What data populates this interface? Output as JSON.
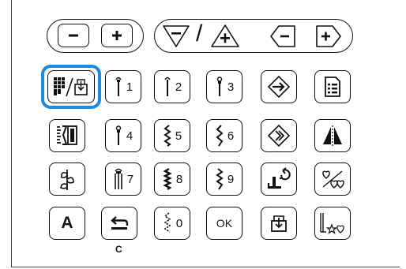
{
  "top_bar": {
    "width_minus": {
      "icon": "minus-icon"
    },
    "width_plus": {
      "icon": "plus-icon"
    },
    "length_minus": {
      "icon": "triangle-minus-icon"
    },
    "separator": "/",
    "length_plus": {
      "icon": "triangle-plus-icon"
    },
    "left_adjust": {
      "icon": "left-arrow-minus-icon"
    },
    "right_adjust": {
      "icon": "right-arrow-plus-icon"
    }
  },
  "keypad": {
    "rows": [
      [
        {
          "name": "stitch-pattern-select-button",
          "icon": "stitch-grid-icon",
          "selected": true,
          "accent": "#1f8be0"
        },
        {
          "name": "stitch-1-button",
          "number": "1",
          "icon": "straight-stitch-icon"
        },
        {
          "name": "stitch-2-button",
          "number": "2",
          "icon": "straight-stitch-icon"
        },
        {
          "name": "stitch-3-button",
          "number": "3",
          "icon": "straight-stitch-icon"
        },
        {
          "name": "next-button",
          "icon": "arrow-right-icon"
        },
        {
          "name": "memory-button",
          "icon": "memo-list-icon"
        }
      ],
      [
        {
          "name": "buttonhole-button",
          "icon": "buttonhole-icon"
        },
        {
          "name": "stitch-4-button",
          "number": "4",
          "icon": "straight-stitch-icon"
        },
        {
          "name": "stitch-5-button",
          "number": "5",
          "icon": "zigzag-stitch-icon"
        },
        {
          "name": "stitch-6-button",
          "number": "6",
          "icon": "zigzag-stitch-icon"
        },
        {
          "name": "reinforce-button",
          "icon": "diamond-arrow-icon"
        },
        {
          "name": "mirror-button",
          "icon": "mirror-icon"
        }
      ],
      [
        {
          "name": "decorative-button",
          "icon": "decorative-leaf-icon"
        },
        {
          "name": "stitch-7-button",
          "number": "7",
          "icon": "triple-stitch-icon"
        },
        {
          "name": "stitch-8-button",
          "number": "8",
          "icon": "zigzag-stitch-icon"
        },
        {
          "name": "stitch-9-button",
          "number": "9",
          "icon": "zigzag-stitch-icon"
        },
        {
          "name": "presser-foot-button",
          "icon": "presser-foot-icon"
        },
        {
          "name": "heart-pattern-button",
          "icon": "heart-pattern-icon"
        }
      ],
      [
        {
          "name": "character-button",
          "label": "A",
          "icon": "letter-a-icon"
        },
        {
          "name": "return-button",
          "icon": "return-arrow-icon",
          "caption": "C"
        },
        {
          "name": "stitch-0-button",
          "number": "0",
          "icon": "zigzag-stitch-icon"
        },
        {
          "name": "ok-button",
          "label": "OK"
        },
        {
          "name": "save-pattern-button",
          "icon": "save-box-icon"
        },
        {
          "name": "pattern-preview-button",
          "icon": "stitch-pattern-preview-icon"
        }
      ]
    ]
  }
}
